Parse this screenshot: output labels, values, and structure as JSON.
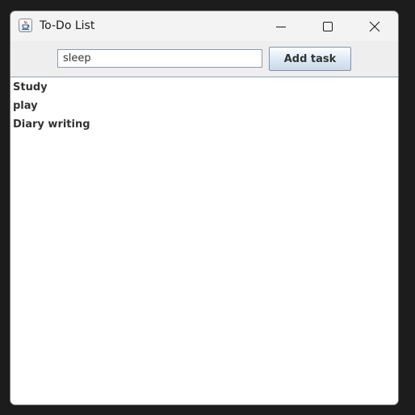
{
  "window": {
    "title": "To-Do List",
    "icon": "java-cup-icon",
    "controls": [
      "minimize-icon",
      "maximize-icon",
      "close-icon"
    ]
  },
  "toolbar": {
    "input_value": "sleep",
    "add_label": "Add task"
  },
  "tasks": [
    "Study",
    "play",
    "Diary writing"
  ],
  "colors": {
    "titlebar": "#f3f3f3",
    "toolbar": "#eeeeee",
    "text": "#333333",
    "border": "#8fa3bd"
  }
}
